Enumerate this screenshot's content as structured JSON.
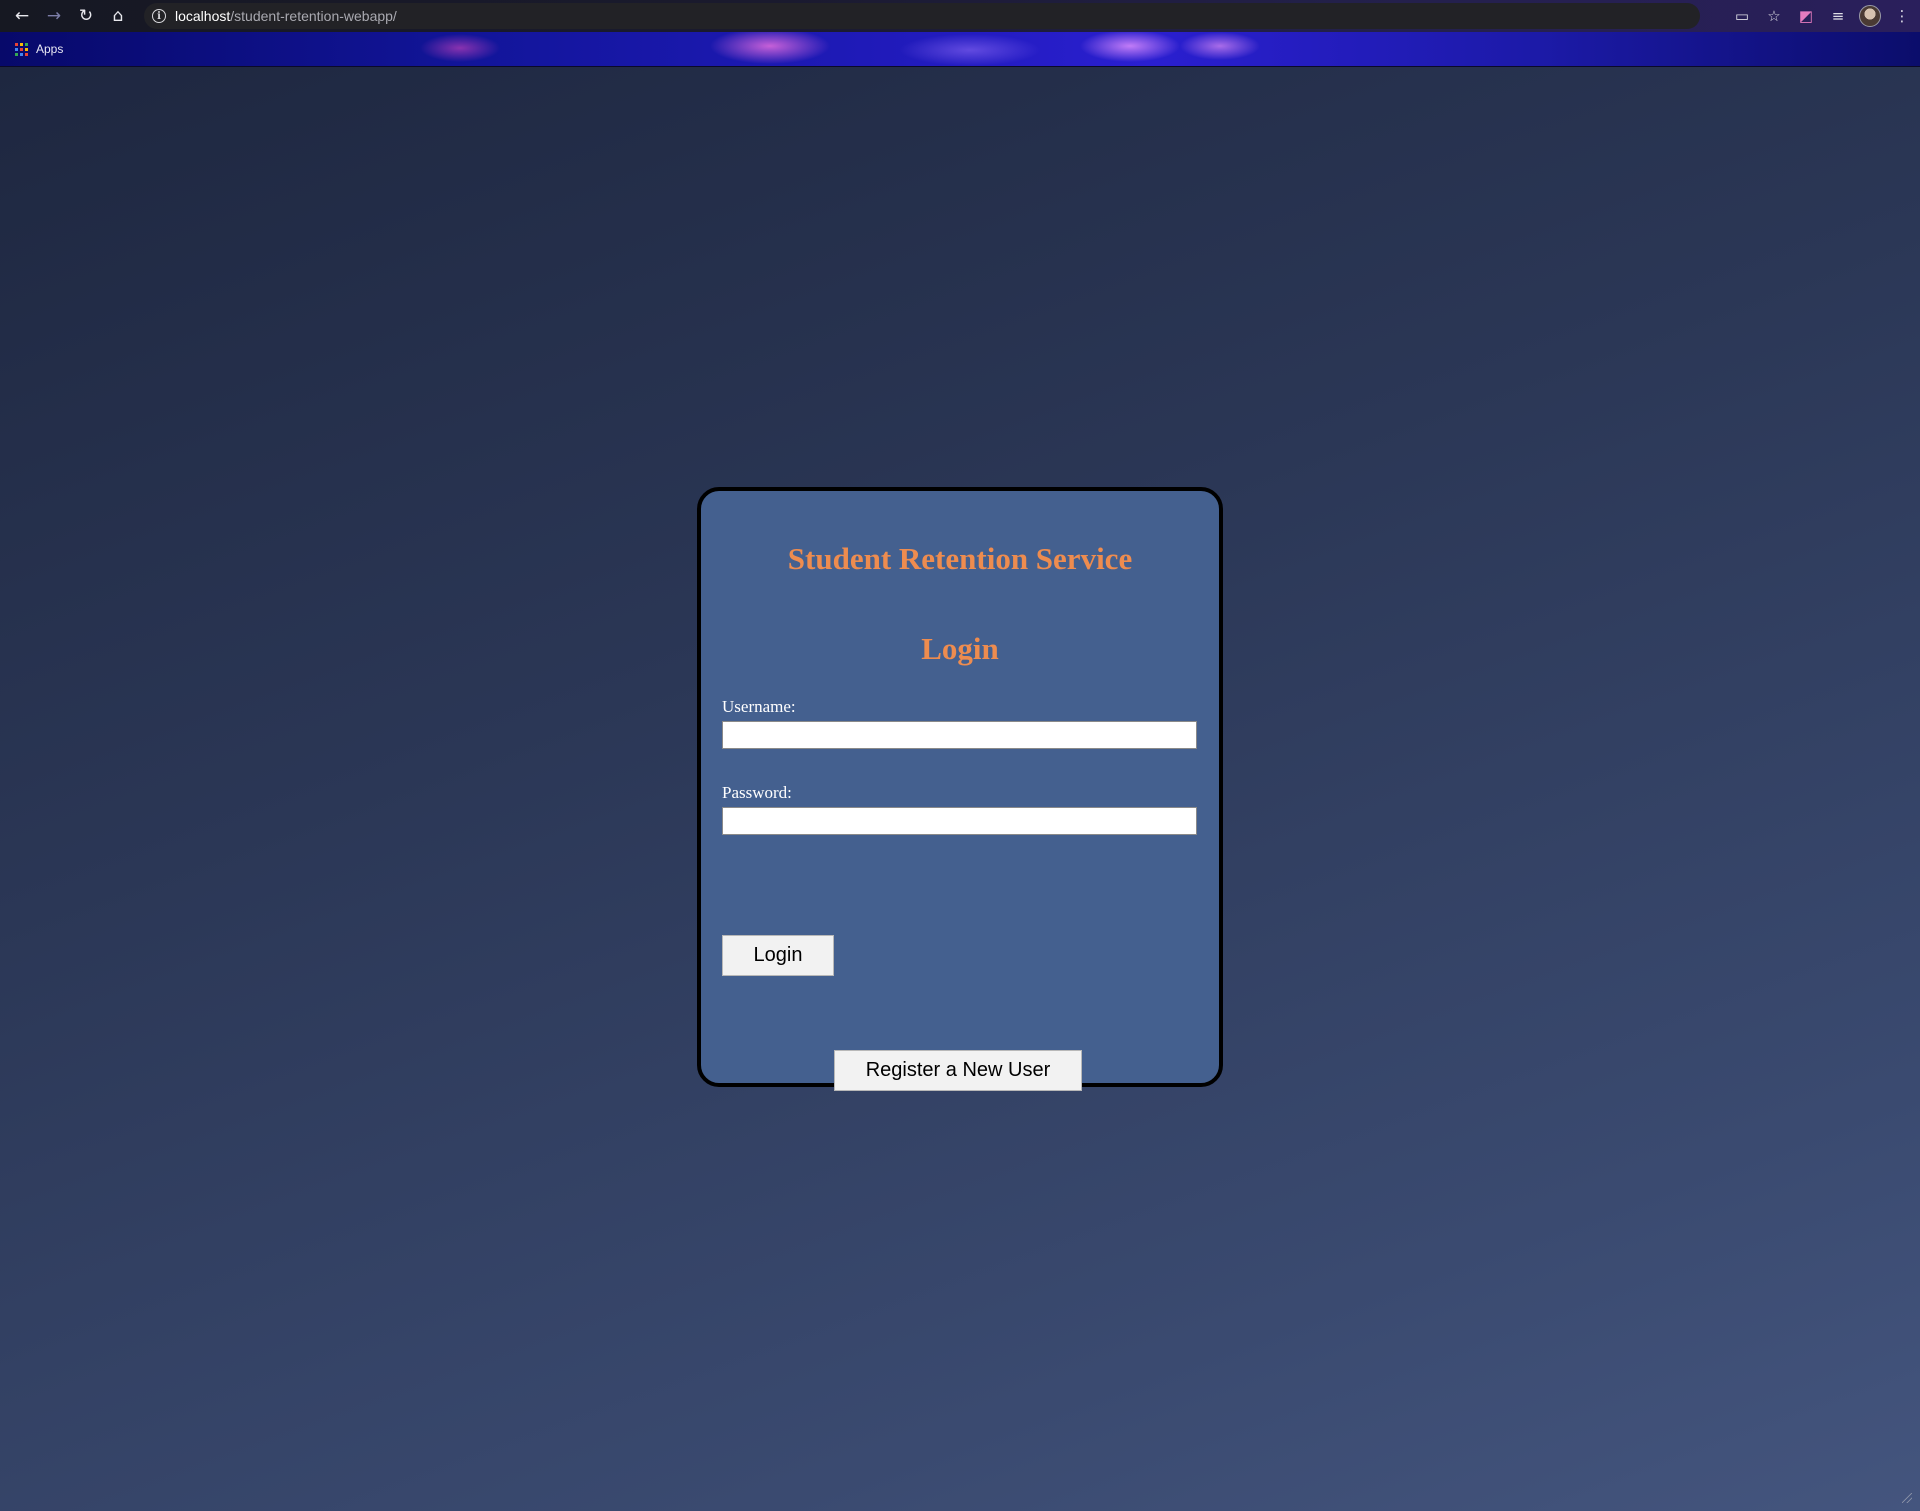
{
  "browser": {
    "url_host": "localhost",
    "url_path": "/student-retention-webapp/",
    "nav": {
      "back": "←",
      "forward": "→",
      "reload": "↻",
      "home": "⌂"
    },
    "info_glyph": "i",
    "right_icons": {
      "cast": "▭",
      "bookmark": "☆",
      "extension": "◩",
      "media": "≡",
      "menu": "⋮"
    },
    "bookmarks_bar": {
      "apps_label": "Apps"
    }
  },
  "page": {
    "title": "Student Retention Service",
    "subtitle": "Login",
    "username": {
      "label": "Username:",
      "value": ""
    },
    "password": {
      "label": "Password:",
      "value": ""
    },
    "login_button": "Login",
    "register_button": "Register a New User"
  },
  "colors": {
    "heading": "#ee8c4f",
    "card_background": "#44608f",
    "card_border": "#000000",
    "page_background": "#2b3756"
  }
}
